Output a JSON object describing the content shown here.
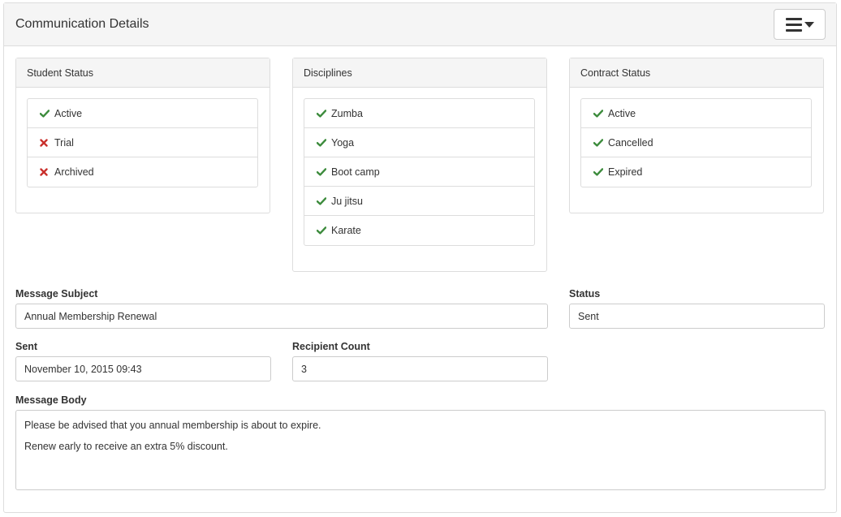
{
  "header": {
    "title": "Communication Details",
    "menu_icon": "hamburger-caret-icon"
  },
  "colors": {
    "check": "#3c8b3c",
    "cross": "#c9302c"
  },
  "student_status": {
    "title": "Student Status",
    "items": [
      {
        "label": "Active",
        "state": "check"
      },
      {
        "label": "Trial",
        "state": "cross"
      },
      {
        "label": "Archived",
        "state": "cross"
      }
    ]
  },
  "disciplines": {
    "title": "Disciplines",
    "items": [
      {
        "label": "Zumba",
        "state": "check"
      },
      {
        "label": "Yoga",
        "state": "check"
      },
      {
        "label": "Boot camp",
        "state": "check"
      },
      {
        "label": "Ju jitsu",
        "state": "check"
      },
      {
        "label": "Karate",
        "state": "check"
      }
    ]
  },
  "contract_status": {
    "title": "Contract Status",
    "items": [
      {
        "label": "Active",
        "state": "check"
      },
      {
        "label": "Cancelled",
        "state": "check"
      },
      {
        "label": "Expired",
        "state": "check"
      }
    ]
  },
  "form": {
    "subject_label": "Message Subject",
    "subject_value": "Annual Membership Renewal",
    "status_label": "Status",
    "status_value": "Sent",
    "sent_label": "Sent",
    "sent_value": "November 10, 2015 09:43",
    "recipient_label": "Recipient Count",
    "recipient_value": "3",
    "body_label": "Message Body",
    "body_lines": [
      "Please be advised that you annual membership is about to expire.",
      "Renew early to receive an extra 5% discount."
    ]
  }
}
